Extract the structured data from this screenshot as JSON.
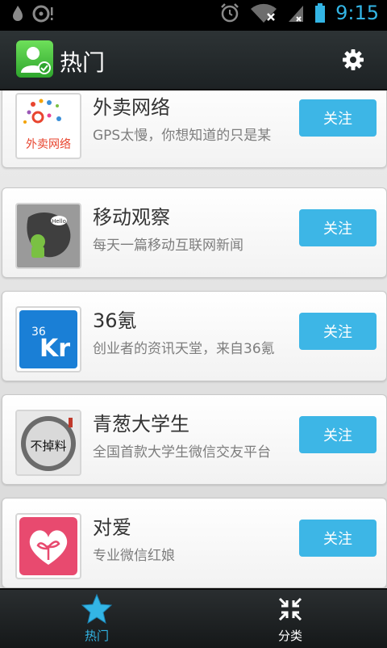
{
  "status_bar": {
    "time": "9:15"
  },
  "header": {
    "title": "热门"
  },
  "follow_label": "关注",
  "items": [
    {
      "name": "外卖网络",
      "desc": "GPS太慢，你想知道的只是某"
    },
    {
      "name": "移动观察",
      "desc": "每天一篇移动互联网新闻"
    },
    {
      "name": "36氪",
      "desc": "创业者的资讯天堂，来自36氪"
    },
    {
      "name": "青葱大学生",
      "desc": "全国首款大学生微信交友平台"
    },
    {
      "name": "对爱",
      "desc": "专业微信红娘"
    }
  ],
  "thumb_text": {
    "waimai": "外卖网络",
    "mobile": "Hello",
    "kr_num": "36",
    "kr_letters": "Kr",
    "qingcong": "不掉料"
  },
  "bottom_nav": {
    "tabs": [
      {
        "label": "热门",
        "active": true,
        "color": "#33b5e5"
      },
      {
        "label": "分类",
        "active": false,
        "color": "#ffffff"
      }
    ]
  },
  "colors": {
    "accent": "#33b5e5",
    "button": "#3db6e6"
  }
}
